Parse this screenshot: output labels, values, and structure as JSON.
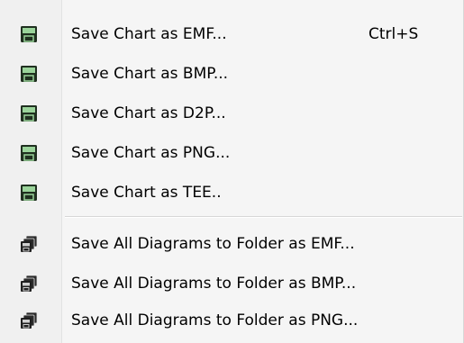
{
  "menu": {
    "items": [
      {
        "label": "Save Chart as EMF...",
        "shortcut": "Ctrl+S",
        "icon": "floppy-disk-icon"
      },
      {
        "label": "Save Chart as BMP...",
        "icon": "floppy-disk-icon"
      },
      {
        "label": "Save Chart as D2P...",
        "icon": "floppy-disk-icon"
      },
      {
        "label": "Save Chart as PNG...",
        "icon": "floppy-disk-icon"
      },
      {
        "label": "Save Chart as TEE..",
        "icon": "floppy-disk-icon"
      },
      {
        "label": "Save All Diagrams  to Folder as EMF...",
        "icon": "multiple-floppy-disks-icon"
      },
      {
        "label": "Save All Diagrams to Folder as BMP...",
        "icon": "multiple-floppy-disks-icon"
      },
      {
        "label": "Save All Diagrams to Folder as PNG...",
        "icon": "multiple-floppy-disks-icon"
      }
    ]
  },
  "colors": {
    "disk_fill": "#2e4a2e",
    "disk_label": "#9ad39a",
    "menu_background": "#f5f5f5"
  }
}
